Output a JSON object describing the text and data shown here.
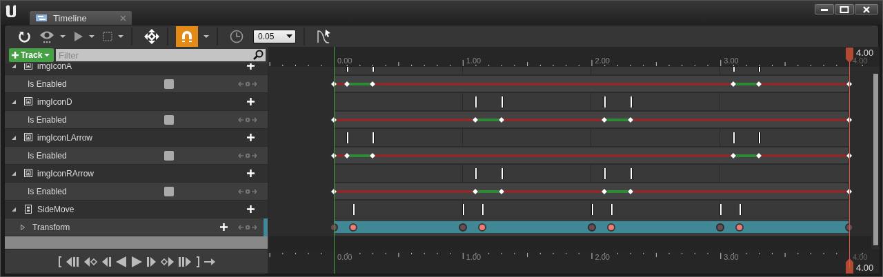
{
  "window": {
    "tab_title": "Timeline"
  },
  "toolbar": {
    "snap": {
      "on": true
    },
    "snap_value": "0.05"
  },
  "track_button": "Track",
  "filter": {
    "placeholder": "Filter"
  },
  "tracks": [
    {
      "name": "imgIconA",
      "kind": "widget",
      "expanded": true,
      "children": [
        {
          "name": "Is Enabled",
          "kind": "bool",
          "checked": false,
          "keys": [
            {
              "level": 0,
              "on": false
            },
            {
              "level": 0.025,
              "on": true
            },
            {
              "level": 0.075,
              "on": false
            },
            {
              "level": 0.775,
              "on": true
            },
            {
              "level": 0.825,
              "on": false
            },
            {
              "level": 1
            }
          ]
        }
      ]
    },
    {
      "name": "imgIconD",
      "kind": "widget",
      "expanded": true,
      "children": [
        {
          "name": "Is Enabled",
          "kind": "bool",
          "checked": false,
          "keys": [
            {
              "level": 0,
              "on": false
            },
            {
              "level": 0.275,
              "on": true
            },
            {
              "level": 0.325,
              "on": false
            },
            {
              "level": 0.525,
              "on": true
            },
            {
              "level": 0.575,
              "on": false
            },
            {
              "level": 1
            }
          ]
        }
      ]
    },
    {
      "name": "imgIconLArrow",
      "kind": "widget",
      "expanded": true,
      "children": [
        {
          "name": "Is Enabled",
          "kind": "bool",
          "checked": false,
          "keys": [
            {
              "level": 0,
              "on": false
            },
            {
              "level": 0.025,
              "on": true
            },
            {
              "level": 0.075,
              "on": false
            },
            {
              "level": 0.775,
              "on": true
            },
            {
              "level": 0.825,
              "on": false
            },
            {
              "level": 1
            }
          ]
        }
      ]
    },
    {
      "name": "imgIconRArrow",
      "kind": "widget",
      "expanded": true,
      "children": [
        {
          "name": "Is Enabled",
          "kind": "bool",
          "checked": false,
          "keys": [
            {
              "level": 0,
              "on": false
            },
            {
              "level": 0.275,
              "on": true
            },
            {
              "level": 0.325,
              "on": false
            },
            {
              "level": 0.525,
              "on": true
            },
            {
              "level": 0.575,
              "on": false
            },
            {
              "level": 1
            }
          ]
        }
      ]
    },
    {
      "name": "SideMove",
      "kind": "component",
      "expanded": true,
      "children": [
        {
          "name": "Transform",
          "kind": "transform",
          "expanded": false,
          "keys": [
            {
              "level": 0,
              "selected": false
            },
            {
              "level": 0.0375,
              "selected": true
            },
            {
              "level": 0.25,
              "selected": false
            },
            {
              "level": 0.2875,
              "selected": true
            },
            {
              "level": 0.5,
              "selected": false
            },
            {
              "level": 0.5375,
              "selected": true
            },
            {
              "level": 0.75,
              "selected": false
            },
            {
              "level": 0.7875,
              "selected": true
            },
            {
              "level": 1,
              "selected": false
            }
          ]
        }
      ]
    }
  ],
  "top_ruler": {
    "labels": [
      "0.00",
      "1.00",
      "2.00",
      "3.00",
      "4.00"
    ],
    "playhead_time": "4.00"
  },
  "bottom_ruler": {
    "labels": [
      "0.00",
      "1.00",
      "2.00",
      "3.00",
      "4.00"
    ],
    "playhead_time": "4.00"
  }
}
